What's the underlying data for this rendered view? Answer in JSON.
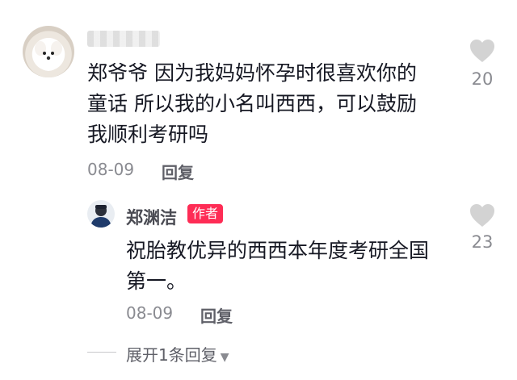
{
  "comment": {
    "username": "",
    "text_lines": [
      "郑爷爷 因为我妈妈怀孕时很喜欢你的",
      "童话 所以我的小名叫西西，可以鼓励",
      "我顺利考研吗"
    ],
    "date": "08-09",
    "reply_label": "回复",
    "likes": "20",
    "like_icon": "heart-icon"
  },
  "reply": {
    "username": "郑渊洁",
    "badge": "作者",
    "text_lines": [
      "祝胎教优异的西西本年度考研全国",
      "第一。"
    ],
    "date": "08-09",
    "reply_label": "回复",
    "likes": "23",
    "like_icon": "heart-icon"
  },
  "expand_label": "展开1条回复",
  "colors": {
    "badge": "#fe2c55",
    "meta": "#8a8b91",
    "heart": "#d3d3d3"
  }
}
